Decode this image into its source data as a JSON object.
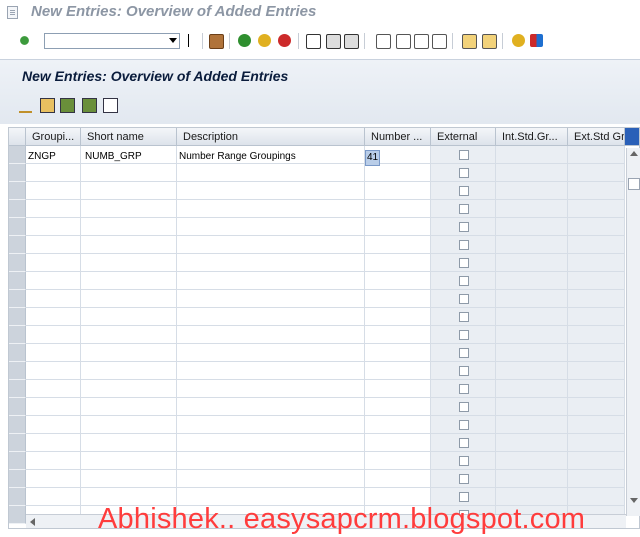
{
  "window": {
    "title": "New Entries: Overview of Added Entries"
  },
  "toolbar": {
    "command_field_value": ""
  },
  "page": {
    "title": "New Entries: Overview of Added Entries"
  },
  "table": {
    "columns": [
      "Groupi...",
      "Short name",
      "Description",
      "Number ...",
      "External",
      "Int.Std.Gr...",
      "Ext.Std Gr"
    ],
    "rows": [
      {
        "group": "ZNGP",
        "short_name": "NUMB_GRP",
        "description": "Number Range Groupings",
        "number": "41",
        "external": false
      }
    ]
  },
  "watermark": "Abhishek.. easysapcrm.blogspot.com",
  "colors": {
    "header_band": "#e8edf3",
    "accent_blue": "#1e6fd0",
    "watermark_red": "#ff3c3c"
  }
}
